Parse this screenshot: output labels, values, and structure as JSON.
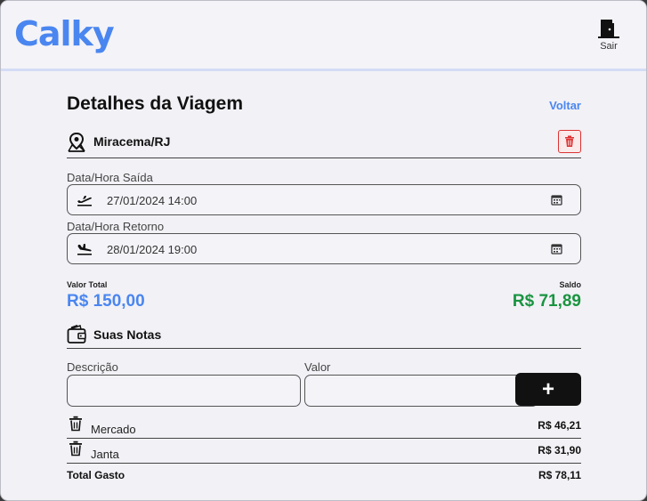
{
  "header": {
    "logo": "Calky",
    "logout_label": "Sair",
    "logout_icon": "door-exit-icon"
  },
  "page": {
    "title": "Detalhes da Viagem",
    "back_label": "Voltar"
  },
  "trip": {
    "destination": "Miracema/RJ",
    "location_icon": "map-pin-icon",
    "delete_icon": "trash-icon"
  },
  "departure": {
    "label": "Data/Hora Saída",
    "value": "27/01/2024 14:00",
    "icon": "plane-takeoff-icon"
  },
  "return": {
    "label": "Data/Hora Retorno",
    "value": "28/01/2024 19:00",
    "icon": "plane-landing-icon"
  },
  "summary": {
    "total_label": "Valor Total",
    "total_value": "R$ 150,00",
    "balance_label": "Saldo",
    "balance_value": "R$ 71,89"
  },
  "notes": {
    "title": "Suas Notas",
    "icon": "wallet-icon",
    "description_label": "Descrição",
    "value_label": "Valor",
    "description_value": "",
    "value_value": "",
    "add_label": "+",
    "items": [
      {
        "description": "Mercado",
        "amount": "R$ 46,21"
      },
      {
        "description": "Janta",
        "amount": "R$ 31,90"
      }
    ],
    "total_label": "Total Gasto",
    "total_value": "R$ 78,11"
  },
  "colors": {
    "accent": "#4a86f0",
    "positive": "#1a9440",
    "danger": "#dd3333",
    "background": "#f2f1f6"
  }
}
